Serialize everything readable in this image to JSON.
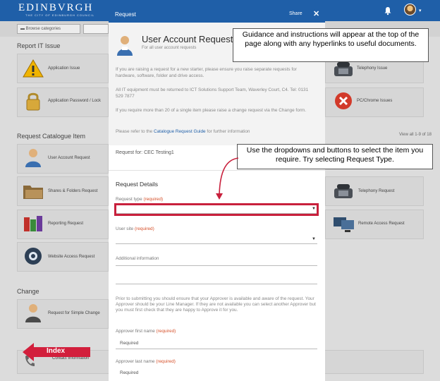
{
  "header": {
    "logo_text": "EDINBVRGH",
    "logo_sub": "THE CITY OF EDINBURGH COUNCIL"
  },
  "toolbar": {
    "browse_label": "Browse categories"
  },
  "background": {
    "report_title": "Report IT Issue",
    "tiles_report": [
      {
        "label": "Application Issue"
      },
      {
        "label": "Application Password / Lock"
      },
      {
        "label": "Telephony Issue"
      },
      {
        "label": "PC/Chrome Issues"
      }
    ],
    "catalogue_title": "Request Catalogue Item",
    "view_all": "View all 1-9 of 18",
    "tiles_catalogue": [
      {
        "label": "User Account Request"
      },
      {
        "label": "Shares & Folders Request"
      },
      {
        "label": "Reporting Request"
      },
      {
        "label": "Website Access Request"
      },
      {
        "label": "Telephony Request"
      },
      {
        "label": "Remote Access Request"
      }
    ],
    "change_title": "Change",
    "tiles_change": [
      {
        "label": "Request for Simple Change"
      }
    ],
    "contact_label": "Contact Information"
  },
  "modal": {
    "header_title": "Request",
    "share_label": "Share",
    "close_glyph": "✕",
    "item_title": "User Account Request",
    "item_subtitle": "For all user account requests",
    "para1": "If you are raising a request for a new starter, please ensure you raise separate requests for hardware, software, folder and drive access.",
    "para2": "All IT equipment must be returned to ICT Solutions Support Team, Waverley Court, C4. Tel: 0131 529 7877",
    "para3": "If you require more than 20 of a single item please raise a change request via the Change form.",
    "para4_prefix": "Please refer to the",
    "para4_link": "Catalogue Request Guide",
    "para4_suffix": "for further information",
    "request_for": "Request for: CEC Testing1",
    "details_title": "Request Details",
    "request_type_label": "Request type",
    "required_tag": "(required)",
    "user_site_label": "User site",
    "additional_info_label": "Additional information",
    "approval_text": "Prior to submitting you should ensure that your Approver is available and aware of the request. Your Approver should be your Line Manager. If they are not available you can select another Approver but you must first check that they are happy to Approve it for you.",
    "approver_first_label": "Approver first name",
    "approver_first_value": "Required",
    "approver_last_label": "Approver last name",
    "approver_last_value": "Required"
  },
  "callouts": {
    "guidance": "Guidance and instructions will appear at the top of the page along with any hyperlinks to useful documents.",
    "dropdowns": "Use the dropdowns and buttons to select the item you require. Try selecting Request Type.",
    "index": "Index"
  },
  "colors": {
    "brand_blue": "#1f5fa8",
    "highlight_red": "#c8203c",
    "required_orange": "#d6502a"
  }
}
